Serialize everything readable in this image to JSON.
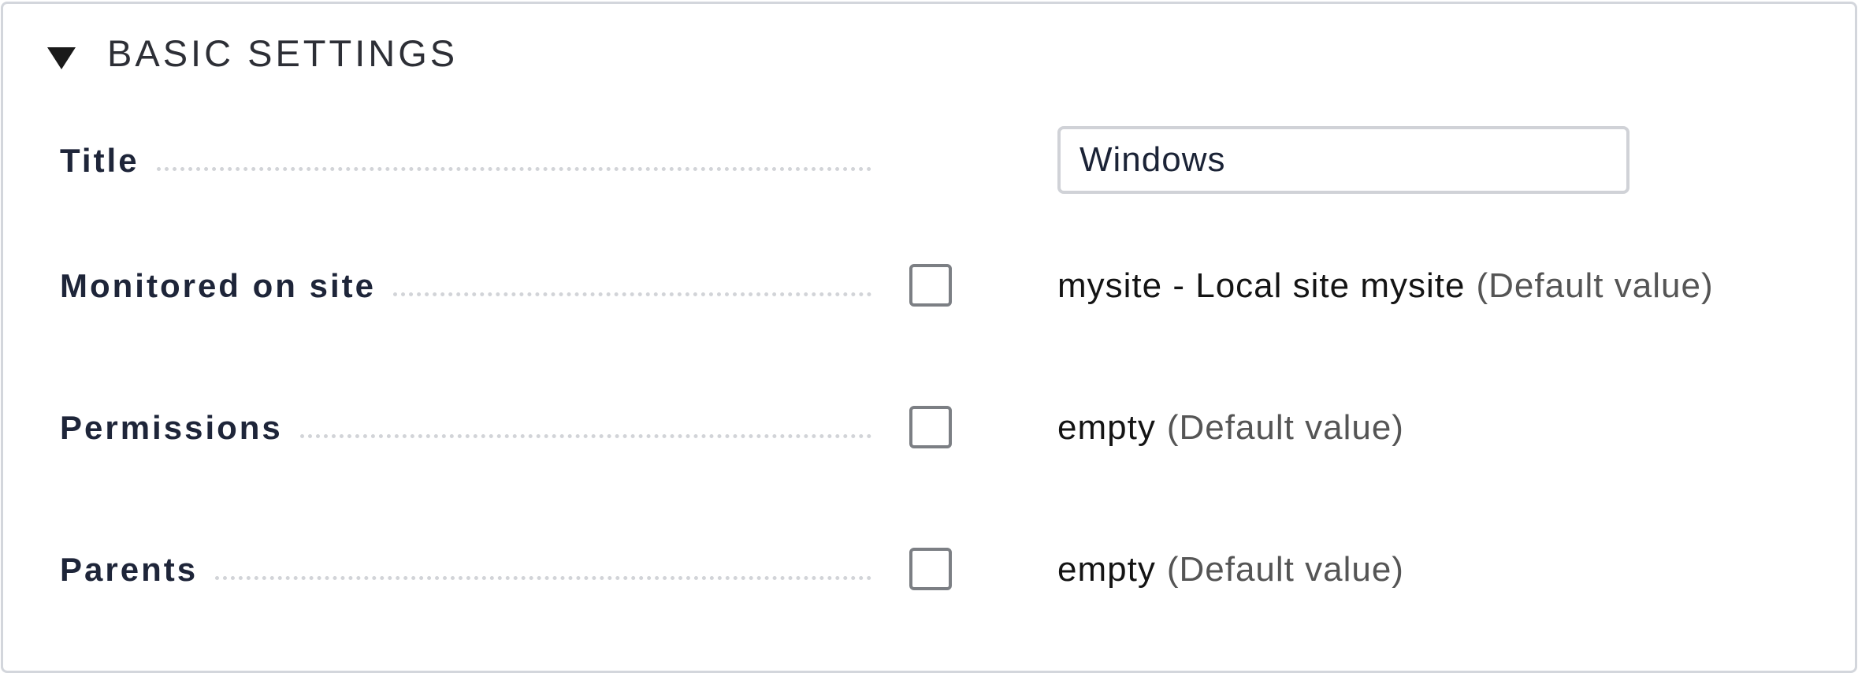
{
  "section": {
    "title": "BASIC SETTINGS",
    "expanded": true,
    "toggle_icon": "triangle-down-icon"
  },
  "fields": {
    "title": {
      "label": "Title",
      "value": "Windows"
    },
    "monitored_on_site": {
      "label": "Monitored on site",
      "checked": false,
      "value": "mysite - Local site mysite",
      "default_note": "(Default value)"
    },
    "permissions": {
      "label": "Permissions",
      "checked": false,
      "value": "empty",
      "default_note": "(Default value)"
    },
    "parents": {
      "label": "Parents",
      "checked": false,
      "value": "empty",
      "default_note": "(Default value)"
    }
  },
  "colors": {
    "label_text": "#1e2539",
    "default_note": "#555555",
    "border": "#d3d6dc",
    "checkbox_border": "#7c7f84"
  }
}
